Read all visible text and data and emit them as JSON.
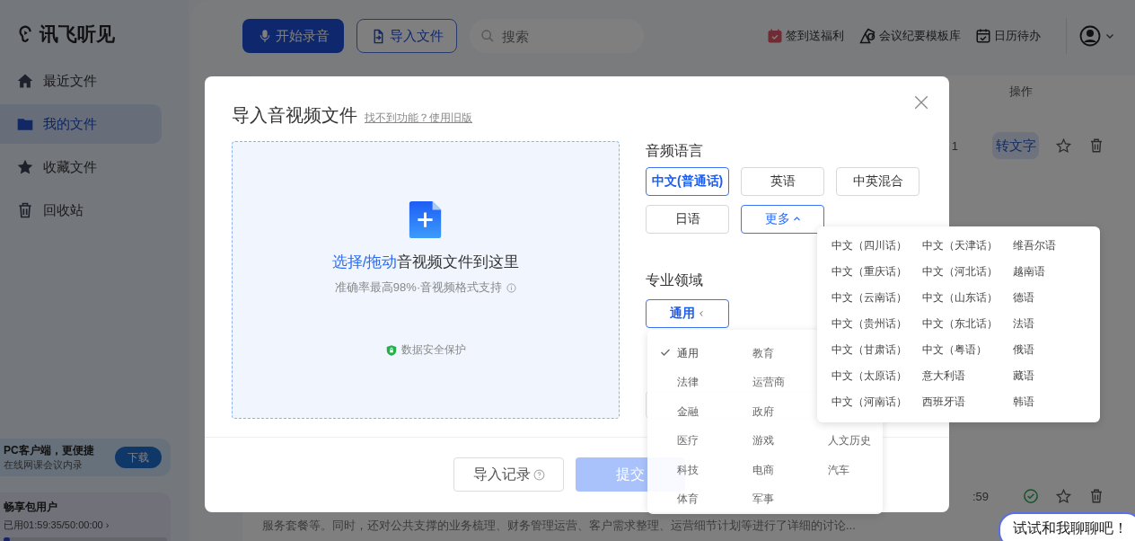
{
  "app": {
    "logo": "讯飞听见"
  },
  "sidebar": {
    "items": [
      {
        "label": "最近文件",
        "kind": "home",
        "selected": false
      },
      {
        "label": "我的文件",
        "kind": "folder",
        "selected": true
      },
      {
        "label": "收藏文件",
        "kind": "star",
        "selected": false
      },
      {
        "label": "回收站",
        "kind": "trash",
        "selected": false
      }
    ],
    "promo": {
      "title": "PC客户端，更便捷",
      "subtitle": "在线网课会议内录",
      "button": "下载"
    },
    "plan": {
      "title": "畅享包用户",
      "usage": "已用01:59:35/50:00:00 ›",
      "level": 0.04
    }
  },
  "toolbar": {
    "record_button": "开始录音",
    "import_button": "导入文件",
    "search": {
      "placeholder": "搜索"
    },
    "links": [
      {
        "label": "签到送福利",
        "kind": "gift"
      },
      {
        "label": "会议纪要模板库",
        "kind": "template"
      },
      {
        "label": "日历待办",
        "kind": "calendar"
      }
    ]
  },
  "file_list": {
    "column_header": "操作",
    "rows": [
      {
        "cell": "1",
        "kind": "convert",
        "button": "转文字"
      },
      {
        "cell": ":59",
        "kind": "done"
      }
    ],
    "summary": "服务套餐等。同时，还对公共支撑的业务梳理、财务管理运营、客户需求整理、运营细节计划等进行了详细的讨论..."
  },
  "dialog": {
    "title": "导入音视频文件",
    "old_version_link": "找不到功能？使用旧版",
    "upload": {
      "prompt_action": "选择/拖动",
      "prompt_rest": "音视频文件到这里",
      "hint": "准确率最高98%·音视频格式支持",
      "security": "数据安全保护"
    },
    "language": {
      "label": "音频语言",
      "options": [
        {
          "label": "中文(普通话)",
          "kind": "option",
          "selected": true
        },
        {
          "label": "英语",
          "kind": "option",
          "selected": false
        },
        {
          "label": "中英混合",
          "kind": "option",
          "selected": false
        },
        {
          "label": "日语",
          "kind": "option",
          "selected": false
        },
        {
          "label": "更多",
          "kind": "more",
          "selected": false,
          "expanded": true
        }
      ],
      "more_menu": [
        "中文（四川话）",
        "中文（天津话）",
        "维吾尔语",
        "中文（重庆话）",
        "中文（河北话）",
        "越南语",
        "中文（云南话）",
        "中文（山东话）",
        "德语",
        "中文（贵州话）",
        "中文（东北话）",
        "法语",
        "中文（甘肃话）",
        "中文（粤语）",
        "俄语",
        "中文（太原话）",
        "意大利语",
        "藏语",
        "中文（河南话）",
        "西班牙语",
        "韩语"
      ]
    },
    "domain": {
      "label": "专业领域",
      "value": "通用",
      "expanded": true,
      "menu_rows": [
        [
          {
            "label": "通用",
            "selected": true
          },
          {
            "label": "教育",
            "selected": false
          }
        ],
        [
          {
            "label": "法律",
            "selected": false
          },
          {
            "label": "运营商",
            "selected": false
          }
        ],
        [
          {
            "label": "金融",
            "selected": false
          },
          {
            "label": "政府",
            "selected": false
          }
        ],
        [
          {
            "label": "医疗",
            "selected": false
          },
          {
            "label": "游戏",
            "selected": false
          },
          {
            "label": "人文历史",
            "selected": false
          }
        ],
        [
          {
            "label": "科技",
            "selected": false
          },
          {
            "label": "电商",
            "selected": false
          },
          {
            "label": "汽车",
            "selected": false
          }
        ],
        [
          {
            "label": "体育",
            "selected": false
          },
          {
            "label": "军事",
            "selected": false
          }
        ]
      ]
    },
    "footer": {
      "history_button": "导入记录",
      "submit_button": {
        "label": "提交",
        "disabled": true
      }
    }
  },
  "chat_bubble": "试试和我聊聊吧！"
}
